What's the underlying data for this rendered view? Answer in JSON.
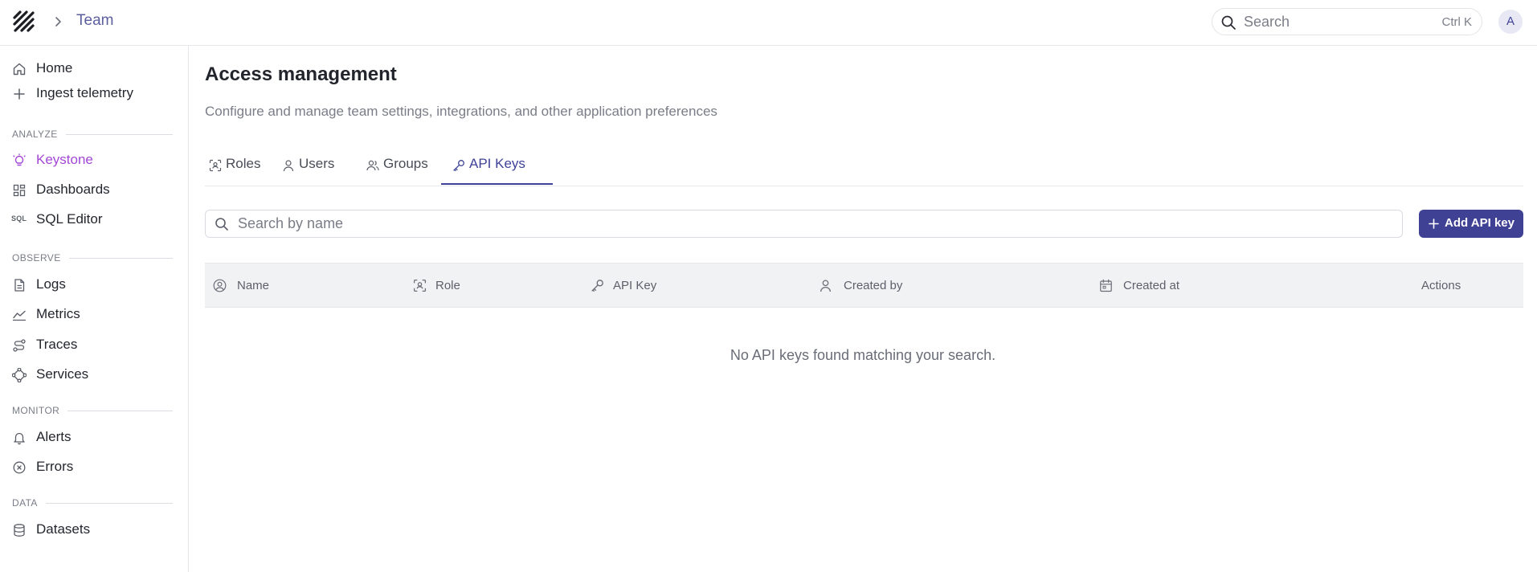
{
  "header": {
    "breadcrumb": "Team",
    "search_placeholder": "Search",
    "search_shortcut": "Ctrl K",
    "avatar_initial": "A"
  },
  "sidebar": {
    "top_items": [
      {
        "label": "Home",
        "icon": "home-icon"
      },
      {
        "label": "Ingest telemetry",
        "icon": "plus-icon"
      }
    ],
    "sections": {
      "analyze": "ANALYZE",
      "observe": "OBSERVE",
      "monitor": "MONITOR",
      "data": "DATA"
    },
    "analyze_items": [
      {
        "label": "Keystone",
        "icon": "lightbulb-icon",
        "active": true
      },
      {
        "label": "Dashboards",
        "icon": "dashboard-icon"
      },
      {
        "label": "SQL Editor",
        "icon": "sql-icon",
        "icon_text": "SQL"
      }
    ],
    "observe_items": [
      {
        "label": "Logs",
        "icon": "file-icon"
      },
      {
        "label": "Metrics",
        "icon": "chart-line-icon"
      },
      {
        "label": "Traces",
        "icon": "route-icon"
      },
      {
        "label": "Services",
        "icon": "network-icon"
      }
    ],
    "monitor_items": [
      {
        "label": "Alerts",
        "icon": "bell-icon"
      },
      {
        "label": "Errors",
        "icon": "circle-x-icon"
      }
    ],
    "data_items": [
      {
        "label": "Datasets",
        "icon": "database-icon"
      }
    ],
    "active_color": "#a347d6"
  },
  "page": {
    "title": "Access management",
    "subtitle": "Configure and manage team settings, integrations, and other application preferences"
  },
  "tabs": [
    {
      "label": "Roles",
      "icon": "role-icon"
    },
    {
      "label": "Users",
      "icon": "user-icon"
    },
    {
      "label": "Groups",
      "icon": "users-icon"
    },
    {
      "label": "API Keys",
      "icon": "key-icon",
      "active": true
    }
  ],
  "toolbar": {
    "search_placeholder": "Search by name",
    "search_value": "",
    "add_label": "Add API key"
  },
  "table": {
    "columns": [
      {
        "label": "Name",
        "icon": "user-circle-icon"
      },
      {
        "label": "Role",
        "icon": "role-icon"
      },
      {
        "label": "API Key",
        "icon": "key-icon"
      },
      {
        "label": "Created by",
        "icon": "user-icon"
      },
      {
        "label": "Created at",
        "icon": "calendar-icon"
      },
      {
        "label": "Actions"
      }
    ],
    "empty_message": "No API keys found matching your search."
  },
  "colors": {
    "accent": "#3f4195",
    "brand_text": "#5c5f9e",
    "active_nav": "#a347d6"
  }
}
